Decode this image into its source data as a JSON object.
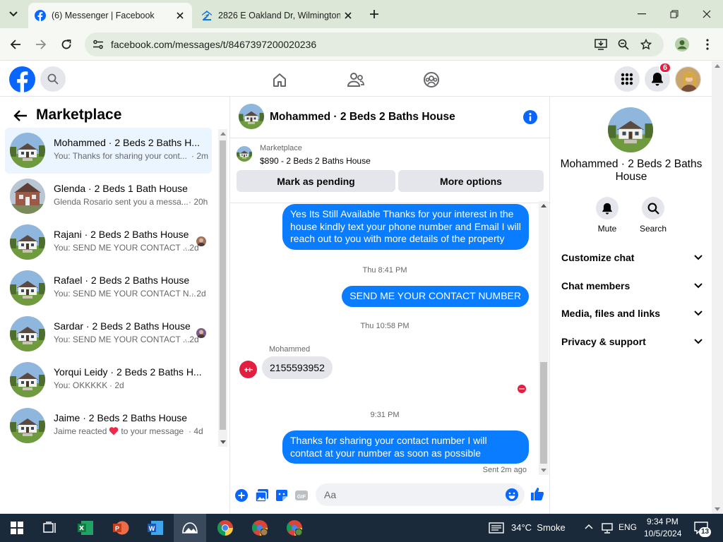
{
  "browser": {
    "tabs": [
      {
        "title": "(6) Messenger | Facebook",
        "active": true
      },
      {
        "title": "2826 E Oakland Dr, Wilmington",
        "active": false
      }
    ],
    "url": "facebook.com/messages/t/8467397200020236"
  },
  "facebook": {
    "notifications_count": "6"
  },
  "marketplace": {
    "title": "Marketplace",
    "chats": [
      {
        "name": "Mohammed · 2 Beds 2 Baths H...",
        "preview": "You: Thanks for sharing your cont...",
        "time": "· 2m",
        "active": true,
        "read_receipt": false
      },
      {
        "name": "Glenda · 2 Beds 1 Bath House",
        "preview": "Glenda Rosario sent you a messa...",
        "time": "· 20h",
        "active": false,
        "read_receipt": false
      },
      {
        "name": "Rajani · 2 Beds 2 Baths House",
        "preview": "You: SEND ME YOUR CONTACT ...",
        "time": "· 2d",
        "active": false,
        "read_receipt": true
      },
      {
        "name": "Rafael · 2 Beds 2 Baths House",
        "preview": "You: SEND ME YOUR CONTACT N...",
        "time": "· 2d",
        "active": false,
        "read_receipt": false
      },
      {
        "name": "Sardar · 2 Beds 2 Baths House",
        "preview": "You: SEND ME YOUR CONTACT ...",
        "time": "· 2d",
        "active": false,
        "read_receipt": true
      },
      {
        "name": "Yorqui Leidy · 2 Beds 2 Baths H...",
        "preview": "You: OKKKKK",
        "time": "· 2d",
        "active": false,
        "read_receipt": false
      },
      {
        "name": "Jaime · 2 Beds 2 Baths House",
        "preview": "Jaime reacted",
        "preview_tail": "to your message",
        "time": "· 4d",
        "active": false,
        "read_receipt": false
      }
    ]
  },
  "conversation": {
    "title": "Mohammed · 2 Beds 2 Baths House",
    "listing": {
      "label": "Marketplace",
      "price_title": "$890 - 2 Beds 2 Baths House",
      "mark_pending": "Mark as pending",
      "more_options": "More options"
    },
    "messages": {
      "m1": "Yes Its Still Available Thanks for your interest in the house kindly text your phone number and Email I will reach out to you with more details of the property",
      "t1": "Thu 8:41 PM",
      "m2": "SEND ME YOUR CONTACT NUMBER",
      "t2": "Thu 10:58 PM",
      "sender": "Mohammed",
      "m3": "2155593952",
      "t3": "9:31 PM",
      "m4": "Thanks for sharing your contact number I will contact at your number as soon as possible",
      "status": "Sent 2m ago"
    },
    "composer_placeholder": "Aa"
  },
  "details": {
    "name": "Mohammed · 2 Beds 2 Baths House",
    "actions": [
      {
        "label": "Mute",
        "icon": "bell-icon"
      },
      {
        "label": "Search",
        "icon": "search-icon"
      }
    ],
    "sections": [
      "Customize chat",
      "Chat members",
      "Media, files and links",
      "Privacy & support"
    ]
  },
  "taskbar": {
    "weather": "34°C  Smoke",
    "language": "ENG",
    "time": "9:34 PM",
    "date": "10/5/2024",
    "notif_count": "13"
  }
}
